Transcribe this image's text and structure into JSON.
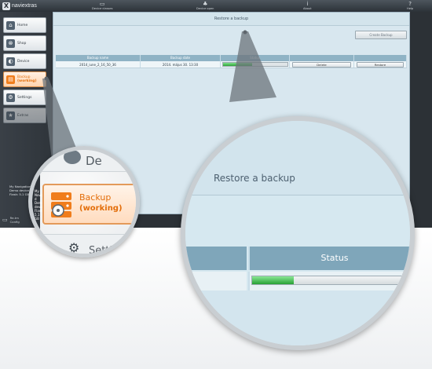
{
  "app": {
    "logo_glyph": "X",
    "logo_text": "naviextras",
    "top_nav": [
      {
        "label": "Device classes",
        "icon": "device-icon",
        "glyph": "▭"
      },
      {
        "label": "Device open",
        "icon": "people-icon",
        "glyph": "♣"
      },
      {
        "label": "About",
        "icon": "info-icon",
        "glyph": "i"
      },
      {
        "label": "Help",
        "icon": "help-icon",
        "glyph": "?"
      }
    ]
  },
  "sidebar": {
    "items": [
      {
        "label": "Home",
        "icon": "home-icon",
        "glyph": "⌂"
      },
      {
        "label": "Shop",
        "icon": "shop-icon",
        "glyph": "⊗"
      },
      {
        "label": "Device",
        "icon": "device-icon",
        "glyph": "◐"
      },
      {
        "label": "Backup",
        "sublabel": "(working)",
        "icon": "backup-icon",
        "glyph": "▤"
      },
      {
        "label": "Settings",
        "icon": "settings-icon",
        "glyph": "⚙"
      },
      {
        "label": "Extras",
        "icon": "star-icon",
        "glyph": "★"
      }
    ],
    "device_info": [
      "My Navigation d",
      "Demo device",
      "Flash: 5.1 GB"
    ],
    "footer": [
      "Re-tm",
      "Config"
    ]
  },
  "content": {
    "title": "Restore a backup",
    "create_button": "Create Backup",
    "columns": [
      "Backup name",
      "Backup date",
      "Status",
      "",
      ""
    ],
    "rows": [
      {
        "name": "2014_iune_2_16_50_36",
        "date": "2014. május 30. 13:30",
        "progress": 0.45,
        "delete_label": "Delete",
        "restore_label": "Restore"
      }
    ]
  },
  "zoom_left": {
    "top_text": "De",
    "button_label": "Backup",
    "button_sublabel": "(working)",
    "bottom_text": "Setti"
  },
  "zoom_right": {
    "title": "Restore a backup",
    "status_header": "Status",
    "progress": 0.25
  },
  "colors": {
    "accent": "#e36e0b",
    "header_blue": "#8fb3c5",
    "progress_green": "#2fa53b"
  }
}
